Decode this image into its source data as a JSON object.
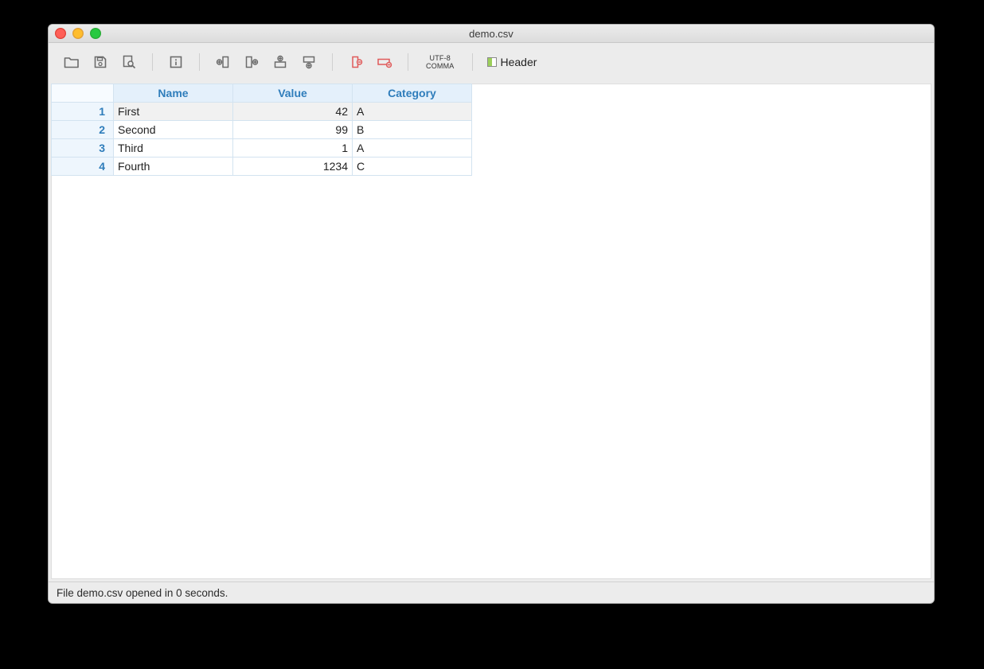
{
  "window": {
    "title": "demo.csv"
  },
  "toolbar": {
    "encoding_line1": "UTF-8",
    "encoding_line2": "COMMA",
    "header_label": "Header"
  },
  "table": {
    "columns": [
      "Name",
      "Value",
      "Category"
    ],
    "rows": [
      {
        "n": "1",
        "name": "First",
        "value": "42",
        "category": "A",
        "selected": true
      },
      {
        "n": "2",
        "name": "Second",
        "value": "99",
        "category": "B",
        "selected": false
      },
      {
        "n": "3",
        "name": "Third",
        "value": "1",
        "category": "A",
        "selected": false
      },
      {
        "n": "4",
        "name": "Fourth",
        "value": "1234",
        "category": "C",
        "selected": false
      }
    ]
  },
  "status": {
    "message": "File demo.csv opened in 0 seconds."
  }
}
